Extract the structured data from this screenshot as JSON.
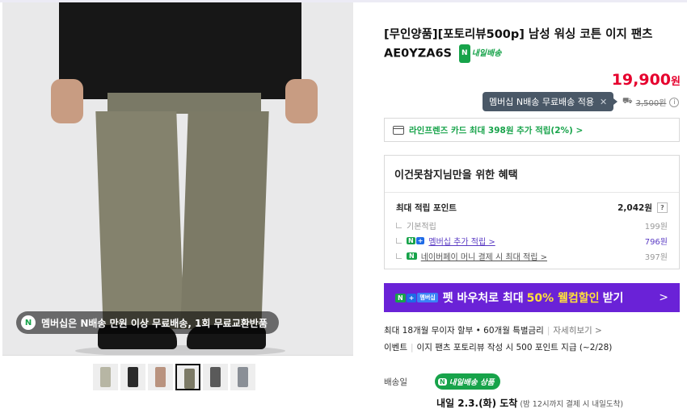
{
  "product": {
    "title_line1": "[무인양품][포토리뷰500p] 남성 워싱 코튼 이지 팬츠",
    "title_line2": "AE0YZA6S",
    "nextday_badge": "내일배송",
    "price": "19,900",
    "price_unit": "원",
    "tooltip": "멤버십 N배송 무료배송 적용",
    "shipping_fee": "3,500원"
  },
  "image": {
    "banner": "멤버십은 N배송 만원 이상 무료배송, 1회 무료교환반품",
    "thumb_count": 6,
    "selected_thumb": 4
  },
  "card_promo": "라인프렌즈 카드 최대 398원 추가 적립(2%) >",
  "benefits": {
    "header": "이건못참지님만을 위한 혜택",
    "max_label": "최대 적립 포인트",
    "max_value": "2,042원",
    "q": "?",
    "rows": [
      {
        "label": "기본적립",
        "value": "199원"
      },
      {
        "label": "멤버십 추가 적립 >",
        "value": "796원"
      },
      {
        "label": "네이버페이 머니 결제 시 최대 적립 >",
        "value": "397원"
      }
    ]
  },
  "promo": {
    "n": "N",
    "plus": "+",
    "membership": "멤버십",
    "text_a": "펫 바우처로 최대",
    "highlight": "50% 웰컴할인",
    "text_b": "받기",
    "arrow": ">"
  },
  "installment": {
    "text": "최대 18개월 무이자 할부 • 60개월 특별금리",
    "more": "자세히보기 >"
  },
  "event": {
    "label": "이벤트",
    "text": "이지 팬츠 포토리뷰 작성 시 500 포인트 지급 (~2/28)"
  },
  "delivery": {
    "label": "배송일",
    "badge": "내일배송 상품",
    "main": "내일 2.3.(화) 도착",
    "sub": "(밤 12시까지 결제 시 내일도착)"
  },
  "colors": {
    "accent_red": "#e6002d",
    "naver_green": "#17a34a",
    "promo_purple": "#6a22d7"
  }
}
